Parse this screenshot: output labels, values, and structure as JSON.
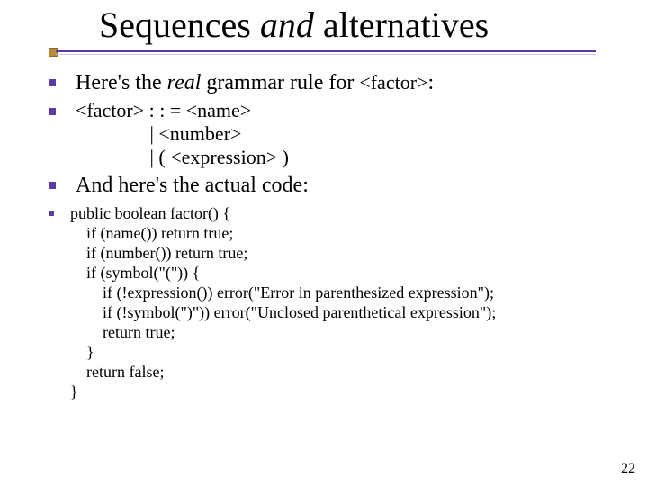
{
  "title": {
    "pre": "Sequences ",
    "and": "and",
    "post": " alternatives"
  },
  "b1": {
    "pre": "Here's the ",
    "real": "real",
    "mid": " grammar rule for ",
    "grammar": "<factor>",
    "post": ":"
  },
  "b2": {
    "grammar": "<factor> : : = <name>\n               | <number>\n               | ( <expression> )"
  },
  "b3": {
    "text": "And here's the actual code:"
  },
  "b4": {
    "code": "public boolean factor() {\n    if (name()) return true;\n    if (number()) return true;\n    if (symbol(\"(\")) {\n        if (!expression()) error(\"Error in parenthesized expression\");\n        if (!symbol(\")\")) error(\"Unclosed parenthetical expression\");\n        return true;\n    }\n    return false;\n}"
  },
  "page": "22"
}
